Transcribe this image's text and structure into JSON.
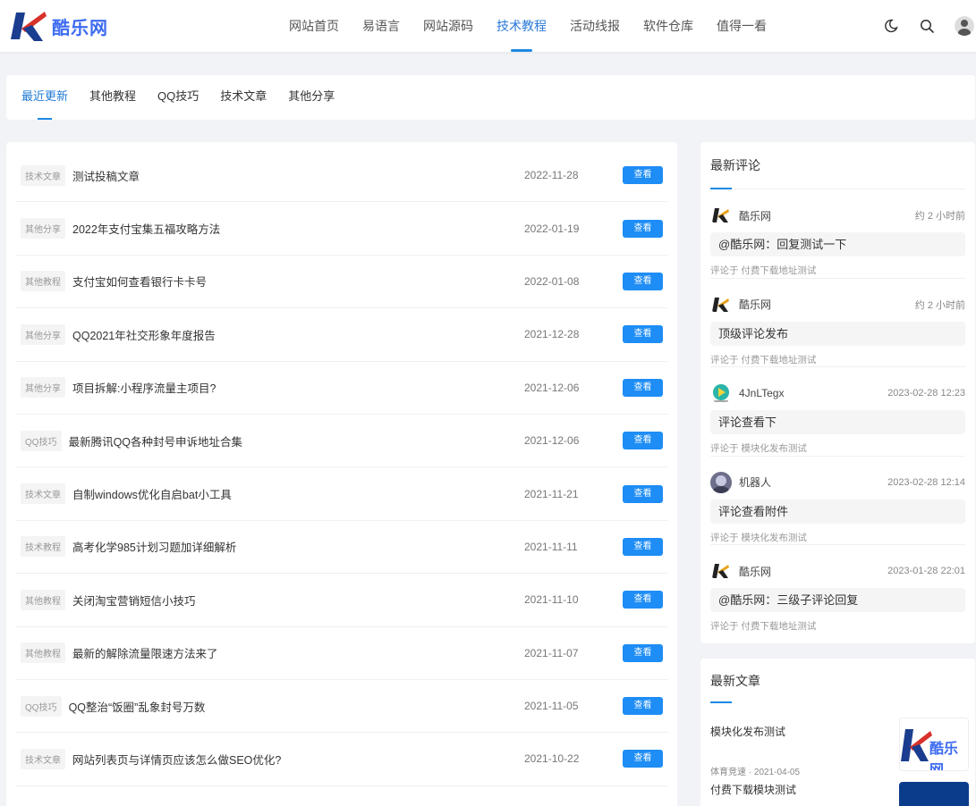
{
  "site": {
    "name": "酷乐网",
    "accent": "#1e88e5",
    "logo_color": "#3d6bf1"
  },
  "nav": {
    "items": [
      {
        "label": "网站首页"
      },
      {
        "label": "易语言"
      },
      {
        "label": "网站源码"
      },
      {
        "label": "技术教程",
        "active": true
      },
      {
        "label": "活动线报"
      },
      {
        "label": "软件仓库"
      },
      {
        "label": "值得一看"
      }
    ],
    "icons": [
      "moon-icon",
      "search-icon",
      "user-avatar"
    ]
  },
  "tabs": [
    {
      "label": "最近更新",
      "active": true
    },
    {
      "label": "其他教程"
    },
    {
      "label": "QQ技巧"
    },
    {
      "label": "技术文章"
    },
    {
      "label": "其他分享"
    }
  ],
  "view_label": "查看",
  "articles": [
    {
      "tag": "技术文章",
      "title": "测试投稿文章",
      "date": "2022-11-28"
    },
    {
      "tag": "其他分享",
      "title": "2022年支付宝集五福攻略方法",
      "date": "2022-01-19"
    },
    {
      "tag": "其他教程",
      "title": "支付宝如何查看银行卡卡号",
      "date": "2022-01-08"
    },
    {
      "tag": "其他分享",
      "title": "QQ2021年社交形象年度报告",
      "date": "2021-12-28"
    },
    {
      "tag": "其他分享",
      "title": "项目拆解:小程序流量主项目?",
      "date": "2021-12-06"
    },
    {
      "tag": "QQ技巧",
      "title": "最新腾讯QQ各种封号申诉地址合集",
      "date": "2021-12-06"
    },
    {
      "tag": "技术文章",
      "title": "自制windows优化自启bat小工具",
      "date": "2021-11-21"
    },
    {
      "tag": "技术教程",
      "title": "高考化学985计划习题加详细解析",
      "date": "2021-11-11"
    },
    {
      "tag": "其他教程",
      "title": "关闭淘宝营销短信小技巧",
      "date": "2021-11-10"
    },
    {
      "tag": "其他教程",
      "title": "最新的解除流量限速方法来了",
      "date": "2021-11-07"
    },
    {
      "tag": "QQ技巧",
      "title": "QQ整治“饭圈”乱象封号万数",
      "date": "2021-11-05"
    },
    {
      "tag": "技术文章",
      "title": "网站列表页与详情页应该怎么做SEO优化?",
      "date": "2021-10-22"
    }
  ],
  "comments_section": {
    "title": "最新评论",
    "items": [
      {
        "user": "酷乐网",
        "time": "约 2 小时前",
        "content": "@酷乐网：回复测试一下",
        "meta": "评论于 付费下载地址测试",
        "avatar": "logo"
      },
      {
        "user": "酷乐网",
        "time": "约 2 小时前",
        "content": "顶级评论发布",
        "meta": "评论于 付费下载地址测试",
        "avatar": "logo"
      },
      {
        "user": "4JnLTegx",
        "time": "2023-02-28 12:23",
        "content": "评论查看下",
        "meta": "评论于 模块化发布测试",
        "avatar": "play"
      },
      {
        "user": "机器人",
        "time": "2023-02-28 12:14",
        "content": "评论查看附件",
        "meta": "评论于 模块化发布测试",
        "avatar": "robot"
      },
      {
        "user": "酷乐网",
        "time": "2023-01-28 22:01",
        "content": "@酷乐网：三级子评论回复",
        "meta": "评论于 付费下载地址测试",
        "avatar": "logo"
      }
    ]
  },
  "posts_section": {
    "title": "最新文章",
    "items": [
      {
        "title": "模块化发布测试",
        "meta": "体育竞速 · 2021-04-05",
        "thumb_text": "酷乐网"
      },
      {
        "title": "付费下载模块测试"
      }
    ]
  }
}
